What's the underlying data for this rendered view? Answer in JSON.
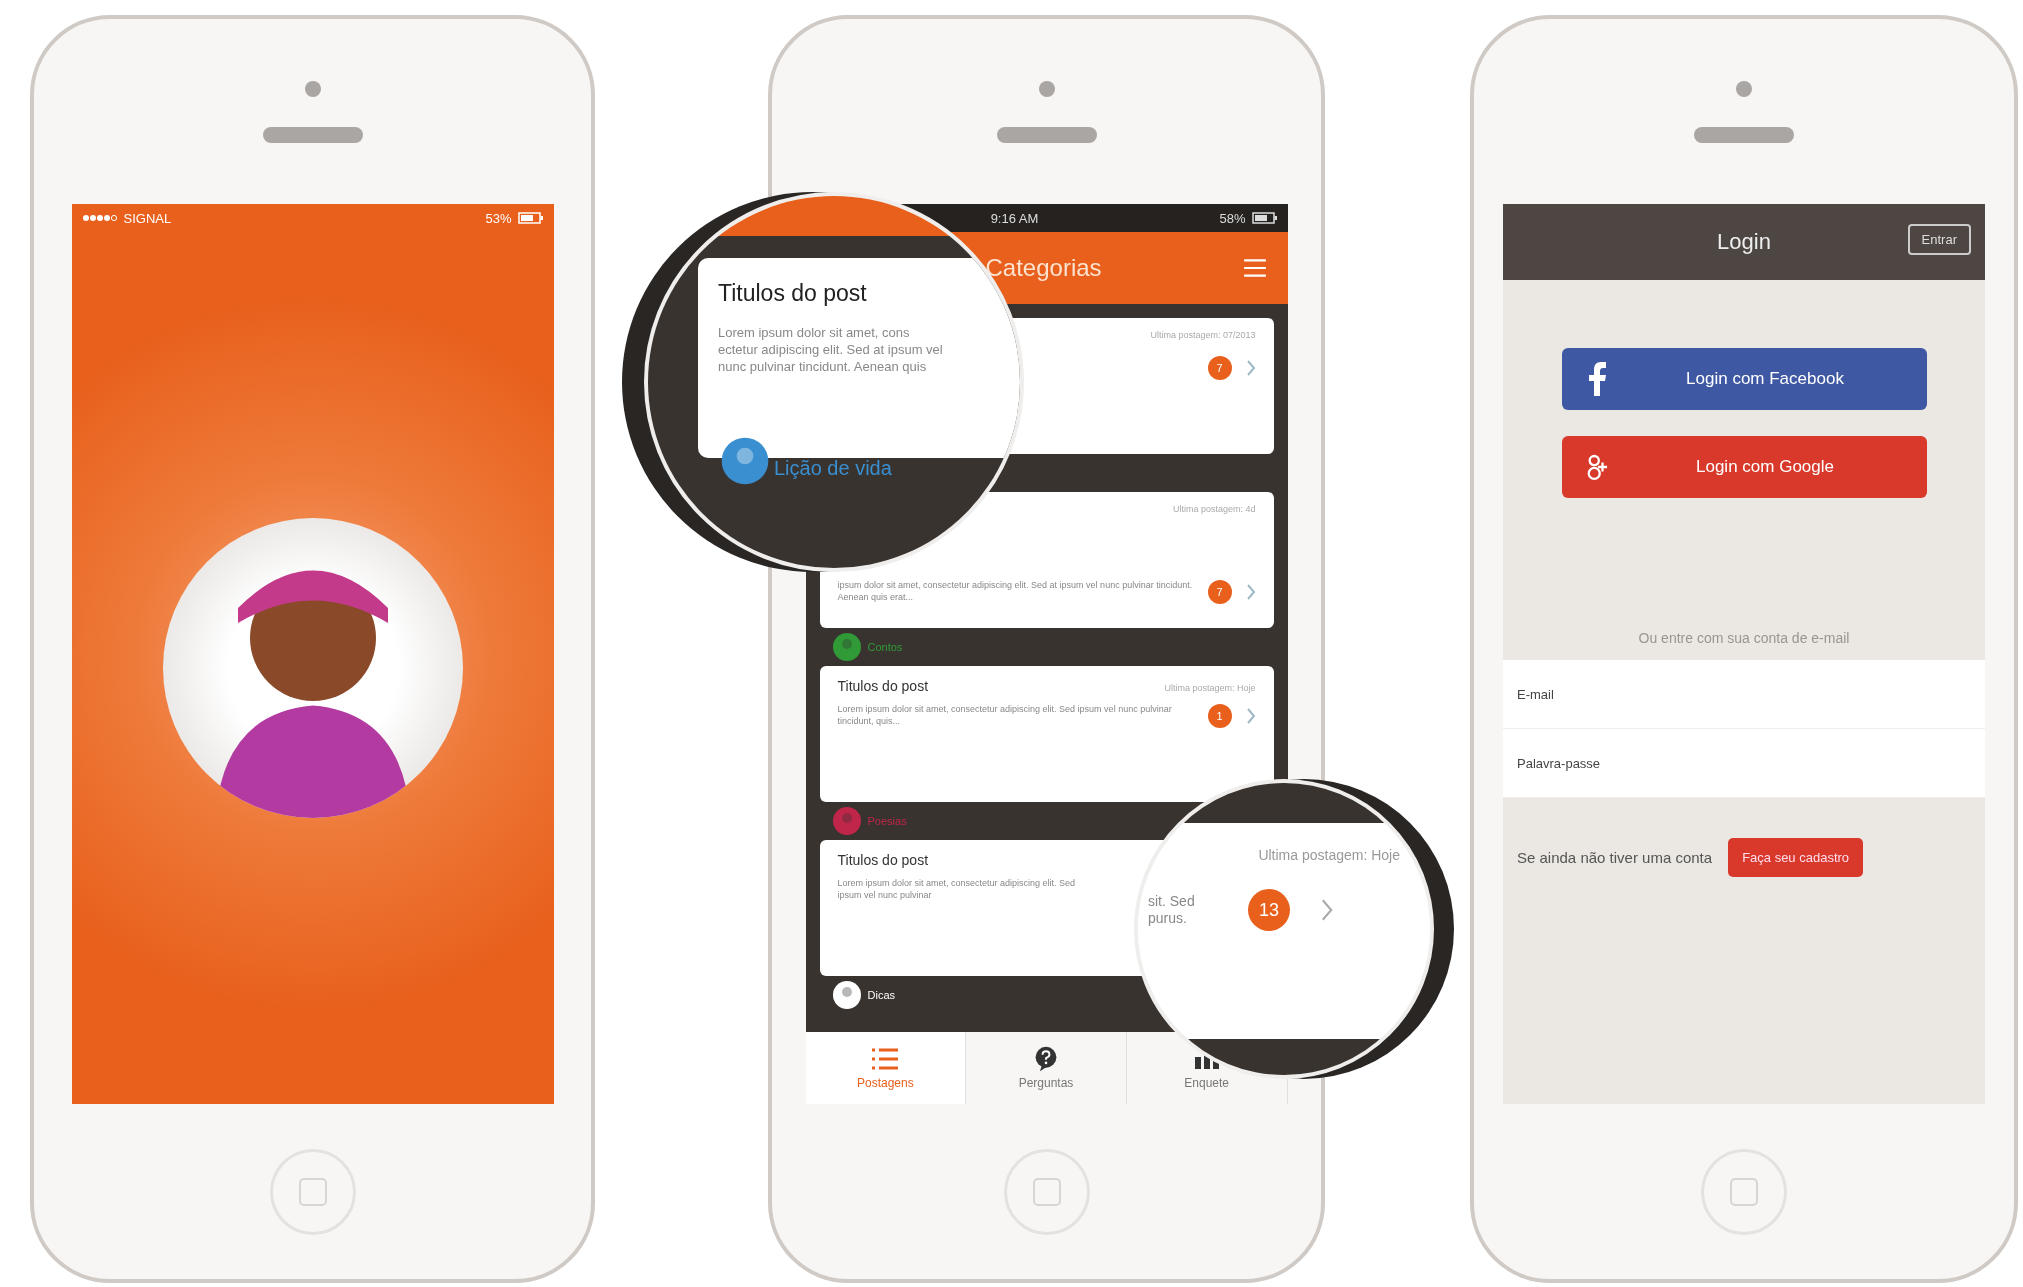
{
  "splash_screen": {
    "status_bar": {
      "carrier": "SIGNAL",
      "battery": "53%"
    }
  },
  "feed_screen": {
    "status_bar": {
      "time": "9:16 AM",
      "battery": "58%"
    },
    "header": {
      "title": "Categorias"
    },
    "posts": [
      {
        "date": "Ultima postagem: 07/2013",
        "count": "7"
      },
      {
        "date": "Ultima postagem: 4d",
        "excerpt": "ipsum dolor sit amet, consectetur adipiscing elit. Sed at ipsum vel nunc pulvinar tincidunt. Aenean quis erat...",
        "count": "7",
        "category": "Contos",
        "color": "#2f9a36"
      },
      {
        "title": "Titulos do post",
        "date": "Ultima postagem: Hoje",
        "excerpt": "Lorem ipsum dolor sit amet, consectetur adipiscing elit. Sed ipsum vel nunc pulvinar tincidunt, quis...",
        "count": "1",
        "category": "Poesias",
        "color": "#c0254a"
      },
      {
        "title": "Titulos do post",
        "excerpt": "Lorem ipsum dolor sit amet, consectetur adipiscing elit. Sed ipsum vel nunc pulvinar",
        "category": "Dicas",
        "color": "#ffffff"
      }
    ],
    "magnifiers": [
      {
        "kind": "post_top",
        "title": "Titulos do post",
        "excerpt": "Lorem ipsum dolor sit amet, cons ectetur adipiscing elit. Sed at ipsum vel nunc pulvinar tincidunt. Aenean quis",
        "category": "Lição de vida",
        "color": "#3a8fd0"
      },
      {
        "kind": "post_side",
        "date": "Ultima postagem: Hoje",
        "excerpt": "sit. Sed purus.",
        "count": "13"
      }
    ],
    "tabs": [
      {
        "label": "Postagens",
        "selected": true
      },
      {
        "label": "Perguntas",
        "selected": false
      },
      {
        "label": "Enquete",
        "selected": false
      }
    ]
  },
  "login_screen": {
    "header": {
      "title": "Login",
      "action": "Entrar"
    },
    "social_buttons": [
      {
        "kind": "facebook",
        "label": "Login com Facebook"
      },
      {
        "kind": "google",
        "label": "Login com Google"
      }
    ],
    "divider_text": "Ou entre com sua conta de e-mail",
    "fields": [
      {
        "label": "E-mail"
      },
      {
        "label": "Palavra-passe"
      }
    ],
    "signup": {
      "text": "Se ainda não tiver uma conta",
      "button": "Faça seu cadastro"
    }
  }
}
